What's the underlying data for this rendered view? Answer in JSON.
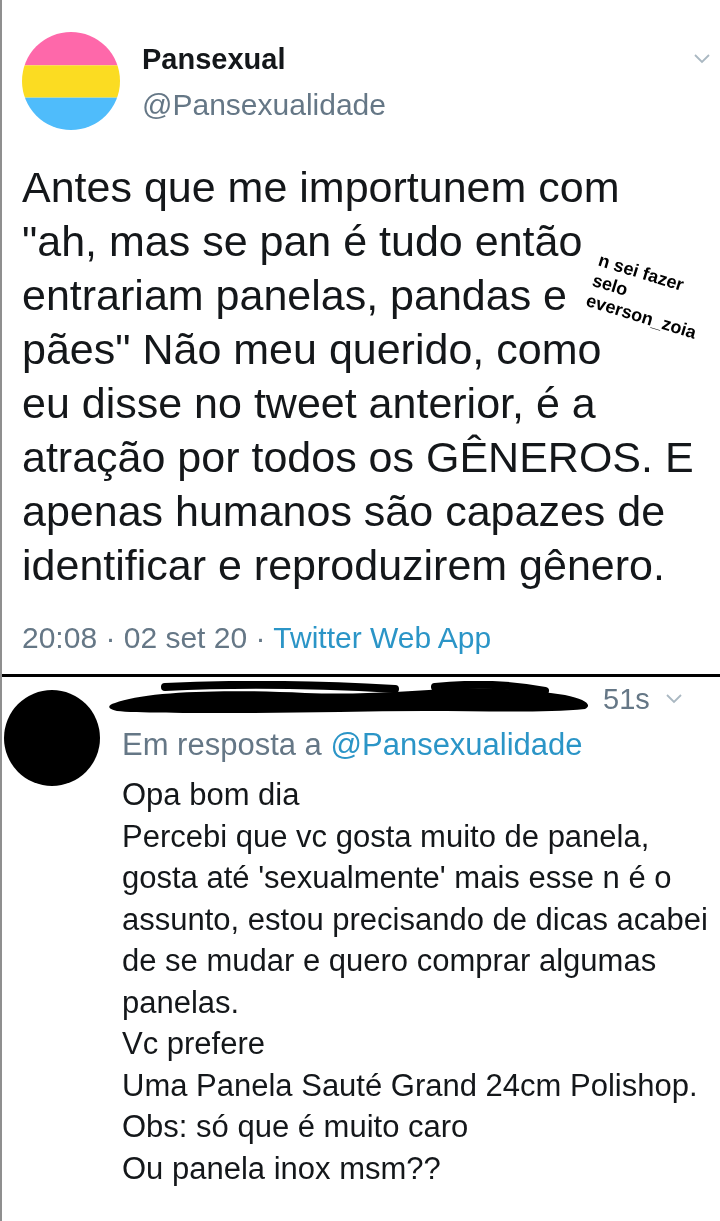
{
  "tweet": {
    "author": {
      "name": "Pansexual",
      "handle": "@Pansexualidade"
    },
    "text_lines": [
      "Antes que me importunem com",
      "\"ah, mas se pan é tudo então",
      "entrariam panelas, pandas e",
      "pães\" Não meu querido, como",
      "eu disse no tweet anterior, é a",
      "atração por todos os GÊNEROS. E",
      "apenas humanos são capazes de",
      "identificar e reproduzirem gênero."
    ],
    "meta": "20:08 · 02 set 20 ·",
    "source": "Twitter Web App"
  },
  "overlay_caption": [
    "n sei fazer",
    "selo",
    "everson_zoia"
  ],
  "reply": {
    "time": "51s",
    "in_reply_to": "Em resposta a",
    "in_reply_to_handle": "@Pansexualidade",
    "paragraphs": [
      "Opa bom dia",
      "Percebi que vc gosta muito de panela, gosta até 'sexualmente' mais esse n é o assunto, estou precisando de dicas acabei de se mudar e quero comprar algumas panelas.",
      "Vc prefere",
      "Uma Panela Sauté Grand 24cm Polishop.",
      "Obs: só que é muito caro",
      "Ou panela inox msm??"
    ]
  }
}
